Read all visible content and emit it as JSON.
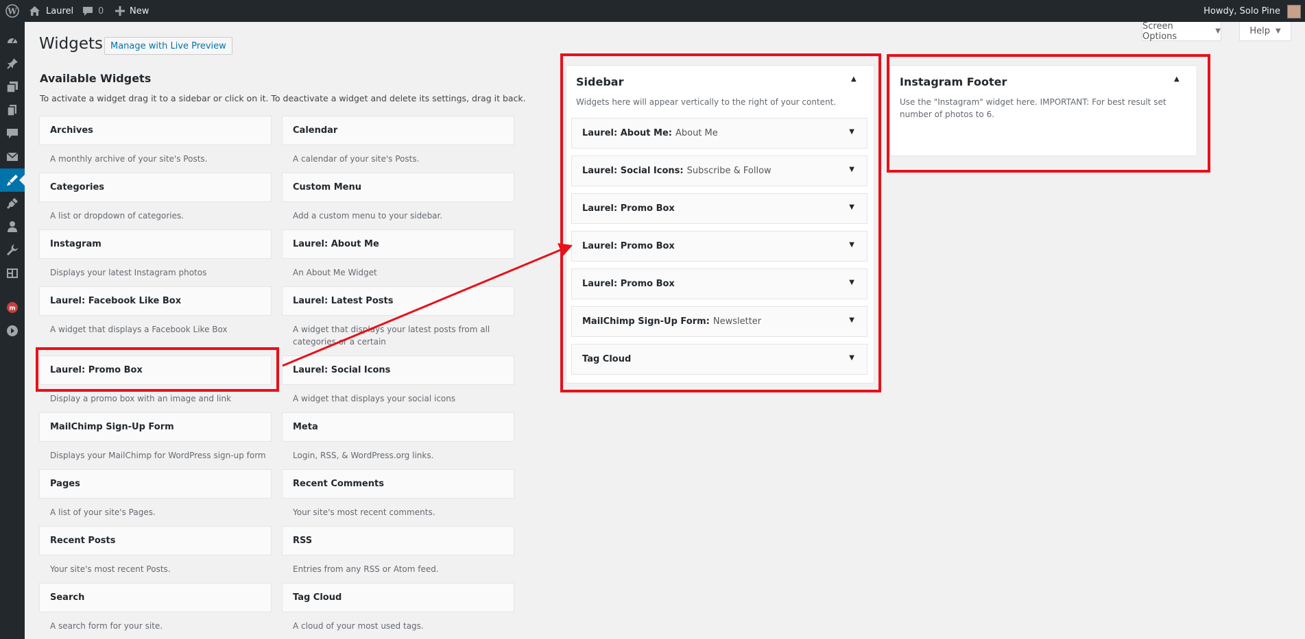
{
  "adminbar": {
    "site_name": "Laurel",
    "comments_count": "0",
    "new_label": "New",
    "howdy": "Howdy, Solo Pine"
  },
  "tabs": {
    "screen_options": "Screen Options",
    "help": "Help"
  },
  "page": {
    "title": "Widgets",
    "live_preview": "Manage with Live Preview",
    "available_title": "Available Widgets",
    "available_desc": "To activate a widget drag it to a sidebar or click on it. To deactivate a widget and delete its settings, drag it back."
  },
  "widgets": [
    {
      "name": "Archives",
      "desc": "A monthly archive of your site's Posts."
    },
    {
      "name": "Calendar",
      "desc": "A calendar of your site's Posts."
    },
    {
      "name": "Categories",
      "desc": "A list or dropdown of categories."
    },
    {
      "name": "Custom Menu",
      "desc": "Add a custom menu to your sidebar."
    },
    {
      "name": "Instagram",
      "desc": "Displays your latest Instagram photos"
    },
    {
      "name": "Laurel: About Me",
      "desc": "An About Me Widget"
    },
    {
      "name": "Laurel: Facebook Like Box",
      "desc": "A widget that displays a Facebook Like Box"
    },
    {
      "name": "Laurel: Latest Posts",
      "desc": "A widget that displays your latest posts from all categories or a certain"
    },
    {
      "name": "Laurel: Promo Box",
      "desc": "Display a promo box with an image and link"
    },
    {
      "name": "Laurel: Social Icons",
      "desc": "A widget that displays your social icons"
    },
    {
      "name": "MailChimp Sign-Up Form",
      "desc": "Displays your MailChimp for WordPress sign-up form"
    },
    {
      "name": "Meta",
      "desc": "Login, RSS, & WordPress.org links."
    },
    {
      "name": "Pages",
      "desc": "A list of your site's Pages."
    },
    {
      "name": "Recent Comments",
      "desc": "Your site's most recent comments."
    },
    {
      "name": "Recent Posts",
      "desc": "Your site's most recent Posts."
    },
    {
      "name": "RSS",
      "desc": "Entries from any RSS or Atom feed."
    },
    {
      "name": "Search",
      "desc": "A search form for your site."
    },
    {
      "name": "Tag Cloud",
      "desc": "A cloud of your most used tags."
    }
  ],
  "sidebar": {
    "title": "Sidebar",
    "desc": "Widgets here will appear vertically to the right of your content.",
    "widgets": [
      {
        "name": "Laurel: About Me:",
        "instance": "About Me"
      },
      {
        "name": "Laurel: Social Icons:",
        "instance": "Subscribe & Follow"
      },
      {
        "name": "Laurel: Promo Box",
        "instance": ""
      },
      {
        "name": "Laurel: Promo Box",
        "instance": ""
      },
      {
        "name": "Laurel: Promo Box",
        "instance": ""
      },
      {
        "name": "MailChimp Sign-Up Form:",
        "instance": "Newsletter"
      },
      {
        "name": "Tag Cloud",
        "instance": ""
      }
    ]
  },
  "footer_sidebar": {
    "title": "Instagram Footer",
    "desc": "Use the \"Instagram\" widget here. IMPORTANT: For best result set number of photos to 6."
  },
  "colors": {
    "adminbar": "#23282d",
    "accent": "#0073aa",
    "annotation": "#e8101a"
  }
}
